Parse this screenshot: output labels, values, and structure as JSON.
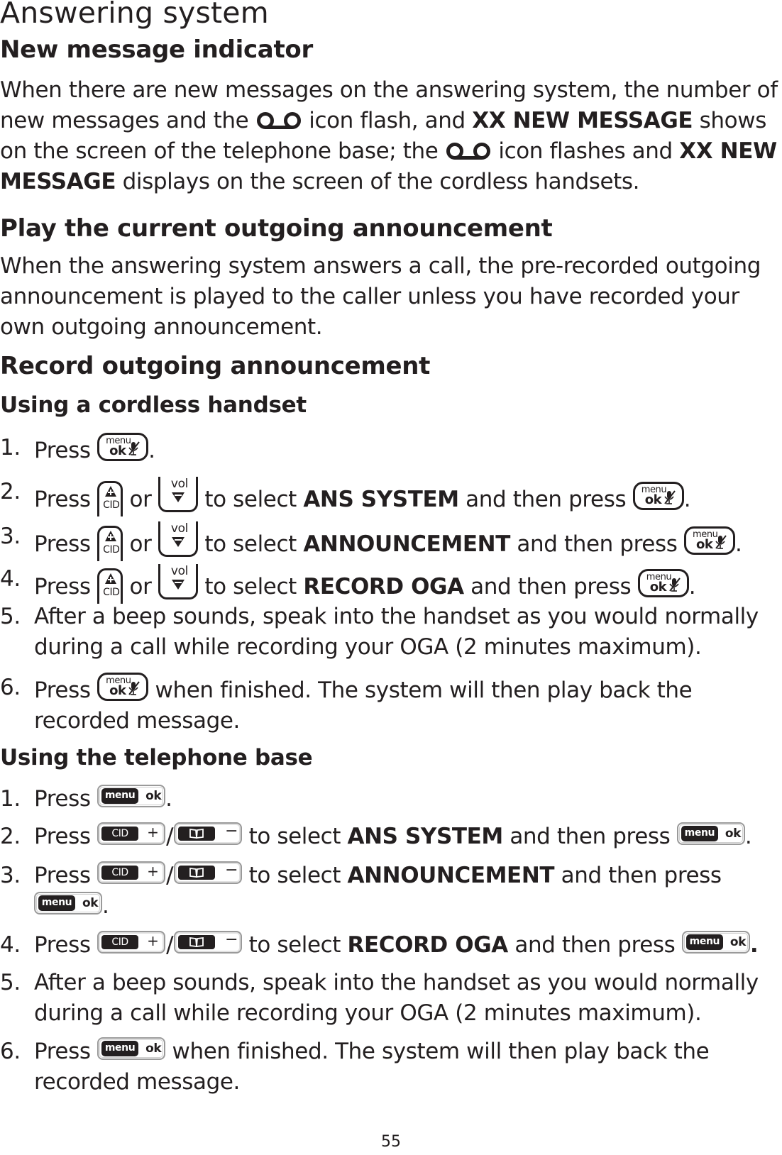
{
  "title": "Answering system",
  "sections": {
    "new_message": {
      "heading": "New message indicator",
      "text_1": "When there are new messages on the answering system, the number of new messages and the",
      "text_2": "icon flash, and",
      "bold_1": "XX NEW MESSAGE",
      "text_3": "shows on the screen of the telephone base; the",
      "text_4": "icon flashes and",
      "bold_2": "XX NEW MESSAGE",
      "text_5": "displays on the screen of the cordless handsets."
    },
    "play_oga": {
      "heading": "Play the current outgoing announcement",
      "text": "When the answering system answers a call, the pre-recorded outgoing announcement is played to the caller unless you have recorded your own outgoing announcement."
    },
    "record_oga": {
      "heading": "Record outgoing announcement",
      "handset": {
        "heading": "Using a cordless handset",
        "steps": [
          {
            "num": "1.",
            "pre": "Press",
            "post": "."
          },
          {
            "num": "2.",
            "pre": "Press",
            "or": "or",
            "mid": "to select",
            "bold": "ANS SYSTEM",
            "tail": "and then press",
            "post": "."
          },
          {
            "num": "3.",
            "pre": "Press",
            "or": "or",
            "mid": "to select",
            "bold": "ANNOUNCEMENT",
            "tail": "and then press",
            "post": "."
          },
          {
            "num": "4.",
            "pre": "Press",
            "or": "or",
            "mid": "to select",
            "bold": "RECORD OGA",
            "tail": "and then press",
            "post": "."
          },
          {
            "num": "5.",
            "text": "After a beep sounds, speak into the handset as you would normally during a call while recording your OGA (2 minutes maximum)."
          },
          {
            "num": "6.",
            "pre": "Press",
            "post": "when finished. The system will then play back the recorded message."
          }
        ]
      },
      "base": {
        "heading": "Using the telephone base",
        "steps": [
          {
            "num": "1.",
            "pre": "Press",
            "post": "."
          },
          {
            "num": "2.",
            "pre": "Press",
            "slash": "/",
            "mid": "to select",
            "bold": "ANS SYSTEM",
            "tail": "and then press",
            "post": "."
          },
          {
            "num": "3.",
            "pre": "Press",
            "slash": "/",
            "mid": "to select",
            "bold": "ANNOUNCEMENT",
            "tail": "and then press",
            "post": "."
          },
          {
            "num": "4.",
            "pre": "Press",
            "slash": "/",
            "mid": "to select",
            "bold": "RECORD OGA",
            "tail": "and then press",
            "post": "."
          },
          {
            "num": "5.",
            "text": "After a beep sounds, speak into the handset as you would normally during a call while recording your OGA (2 minutes maximum)."
          },
          {
            "num": "6.",
            "pre": "Press",
            "post": "when finished. The system will then play back the recorded message."
          }
        ]
      }
    }
  },
  "keys": {
    "handset_menu": "menu",
    "handset_ok": "ok",
    "handset_cid": "CID",
    "handset_vol": "vol",
    "base_menu": "menu",
    "base_ok": "ok",
    "base_cid": "CID",
    "base_plus": "+",
    "base_minus": "−"
  },
  "icons": {
    "voicemail": "voicemail-icon",
    "mute": "mute-mic-icon",
    "up_arrow": "up-triangle-plus-icon",
    "down_arrow": "down-triangle-minus-icon",
    "phonebook": "phonebook-icon"
  },
  "page_number": "55"
}
